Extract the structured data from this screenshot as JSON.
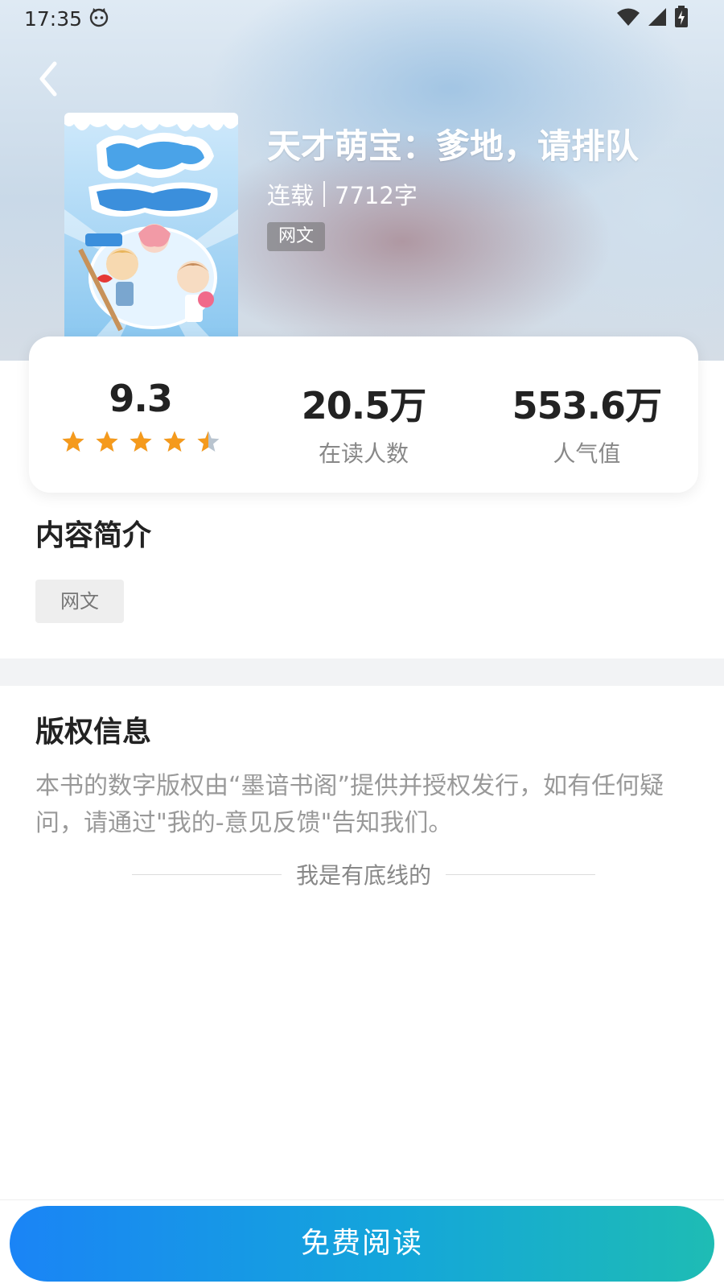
{
  "status_bar": {
    "time": "17:35",
    "icons": [
      "cat-face-icon",
      "wifi-icon",
      "cellular-signal-icon",
      "battery-charging-icon"
    ]
  },
  "header": {
    "back_icon": "chevron-left-icon"
  },
  "book": {
    "title": "天才萌宝：爹地，请排队",
    "status": "连载",
    "word_count": "7712字",
    "tag": "网文"
  },
  "stats": {
    "rating": "9.3",
    "rating_stars": 4.5,
    "readers_value": "20.5万",
    "readers_label": "在读人数",
    "popularity_value": "553.6万",
    "popularity_label": "人气值"
  },
  "intro": {
    "title": "内容简介",
    "tag": "网文"
  },
  "copyright": {
    "title": "版权信息",
    "text": "本书的数字版权由“墨谙书阁”提供并授权发行，如有任何疑问，请通过\"我的-意见反馈\"告知我们。",
    "bottom_line": "我是有底线的"
  },
  "action": {
    "read_label": "免费阅读"
  },
  "colors": {
    "star": "#f59a1c",
    "button_start": "#1a84f6",
    "button_end": "#1ebcb4"
  }
}
